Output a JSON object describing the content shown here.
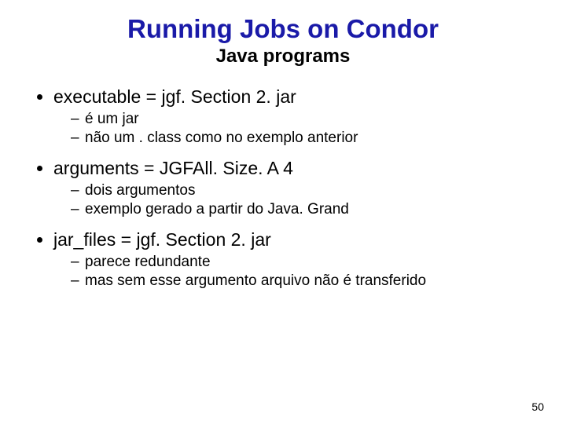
{
  "title": "Running Jobs on Condor",
  "subtitle": "Java programs",
  "bullets": [
    {
      "text": "executable = jgf. Section 2. jar",
      "sub": [
        "é um jar",
        "não um . class como no exemplo anterior"
      ]
    },
    {
      "text": "arguments  = JGFAll. Size. A 4",
      "sub": [
        "dois argumentos",
        "exemplo gerado a partir do Java. Grand"
      ]
    },
    {
      "text": "jar_files = jgf. Section 2. jar",
      "sub": [
        "parece redundante",
        "mas sem esse argumento arquivo não é transferido"
      ]
    }
  ],
  "page_number": "50"
}
